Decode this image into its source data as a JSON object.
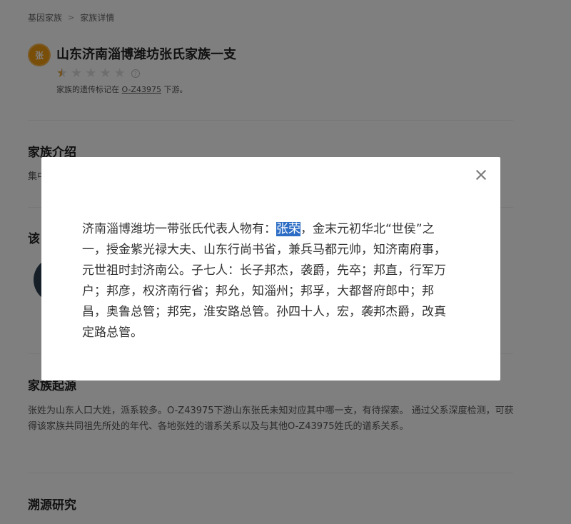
{
  "breadcrumb": {
    "root": "基因家族",
    "separator": ">",
    "current": "家族详情"
  },
  "family": {
    "avatar_text": "张",
    "title": "山东济南淄博潍坊张氏家族一支",
    "rating": 0.5,
    "rating_max": 5,
    "marker_prefix": "家族的遗传标记在",
    "marker_code": "O-Z43975",
    "marker_suffix": "下游。"
  },
  "sections": {
    "intro_title": "家族介绍",
    "intro_body_visible": "集中",
    "figures_title_visible": "该",
    "origin_title": "家族起源",
    "origin_body": "张姓为山东人口大姓，派系较多。O-Z43975下游山东张氏未知对应其中哪一支，有待探索。 通过父系深度检测，可获得该家族共同祖先所处的年代、各地张姓的谱系关系以及与其他O-Z43975姓氏的谱系关系。",
    "research_title": "溯源研究"
  },
  "modal": {
    "text_before": "济南淄博潍坊一带张氏代表人物有：",
    "highlight": "张荣",
    "text_after": "，金末元初华北“世侯”之一，授金紫光禄大夫、山东行尚书省，兼兵马都元帅，知济南府事，元世祖时封济南公。子七人：长子邦杰，袭爵，先卒；邦直，行军万户；邦彦，权济南行省；邦允，知淄州；邦孚，大都督府郎中；邦昌，奥鲁总管；邦宪，淮安路总管。孙四十人，宏，袭邦杰爵，改真定路总管。"
  },
  "colors": {
    "avatar": "#f39c12",
    "star_active": "#e6a23c",
    "highlight": "#2b6cc4"
  }
}
